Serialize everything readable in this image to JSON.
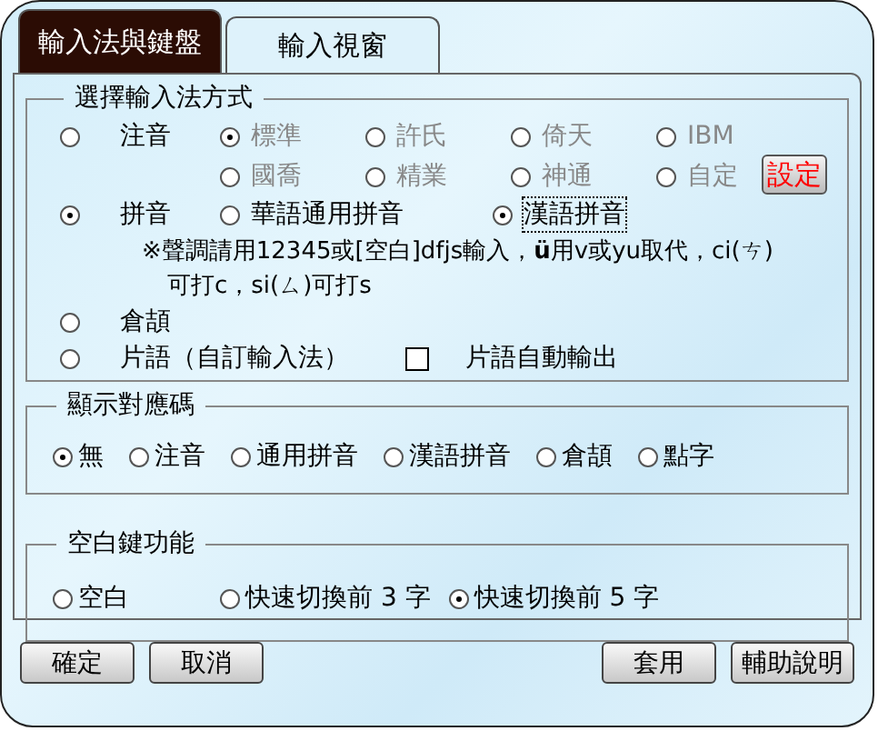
{
  "tabs": [
    {
      "label": "輸入法與鍵盤",
      "selected": true
    },
    {
      "label": "輸入視窗",
      "selected": false
    }
  ],
  "input_method": {
    "title": "選擇輸入法方式",
    "options": [
      {
        "kind": "zhuyin",
        "label": "注音",
        "selected": false,
        "sub_options": [
          {
            "label": "標準",
            "selected": true,
            "disabled": true
          },
          {
            "label": "許氏",
            "selected": false,
            "disabled": true
          },
          {
            "label": "倚天",
            "selected": false,
            "disabled": true
          },
          {
            "label": "IBM",
            "selected": false,
            "disabled": true
          },
          {
            "label": "國喬",
            "selected": false,
            "disabled": true
          },
          {
            "label": "精業",
            "selected": false,
            "disabled": true
          },
          {
            "label": "神通",
            "selected": false,
            "disabled": true
          },
          {
            "label": "自定",
            "selected": false,
            "disabled": true
          }
        ],
        "settings_button": "設定"
      },
      {
        "kind": "pinyin",
        "label": "拼音",
        "selected": true,
        "sub_options": [
          {
            "label": "華語通用拼音",
            "selected": false,
            "focused": false
          },
          {
            "label": "漢語拼音",
            "selected": true,
            "focused": true
          }
        ],
        "note_lines": [
          "※聲調請用12345或[空白]dfjs輸入，**ü**用v或yu取代，ci(ㄘ)",
          "可打c，si(ㄙ)可打s"
        ]
      },
      {
        "kind": "plain",
        "label": "倉頡",
        "selected": false
      },
      {
        "kind": "phrase",
        "label": "片語（自訂輸入法）",
        "selected": false,
        "checkbox": {
          "label": "片語自動輸出",
          "checked": false
        }
      }
    ]
  },
  "display_code": {
    "title": "顯示對應碼",
    "options": [
      {
        "label": "無",
        "selected": true
      },
      {
        "label": "注音",
        "selected": false
      },
      {
        "label": "通用拼音",
        "selected": false
      },
      {
        "label": "漢語拼音",
        "selected": false
      },
      {
        "label": "倉頡",
        "selected": false
      },
      {
        "label": "點字",
        "selected": false
      }
    ]
  },
  "space_key": {
    "title": "空白鍵功能",
    "options": [
      {
        "label": "空白",
        "selected": false
      },
      {
        "label": "快速切換前 3 字",
        "selected": false
      },
      {
        "label": "快速切換前 5 字",
        "selected": true
      }
    ]
  },
  "buttons_left": [
    "確定",
    "取消"
  ],
  "buttons_right": [
    "套用",
    "輔助說明"
  ]
}
